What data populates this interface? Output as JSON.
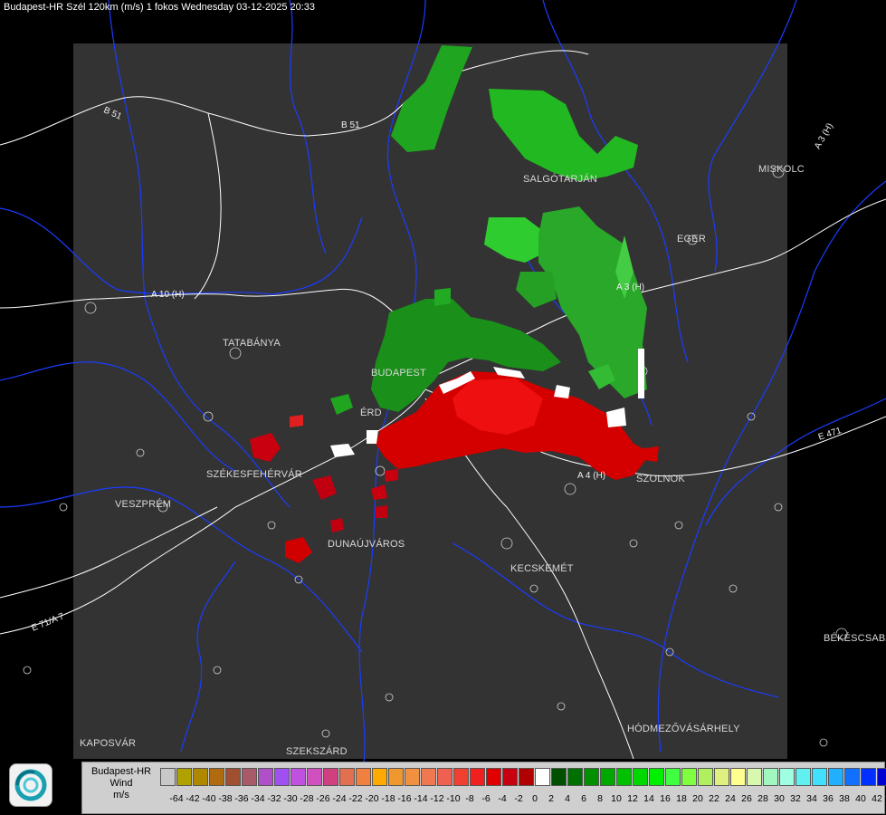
{
  "header": {
    "title": "Budapest-HR Szél 120km (m/s) 1 fokos Wednesday 03-12-2025 20:33"
  },
  "cities": [
    {
      "name": "SALGÓTARJÁN"
    },
    {
      "name": "EGER"
    },
    {
      "name": "MISKOLC"
    },
    {
      "name": "TATABÁNYA"
    },
    {
      "name": "BUDAPEST"
    },
    {
      "name": "ÉRD"
    },
    {
      "name": "SZÉKESFEHÉRVÁR"
    },
    {
      "name": "VESZPRÉM"
    },
    {
      "name": "DUNAÚJVÁROS"
    },
    {
      "name": "KECSKEMÉT"
    },
    {
      "name": "SZOLNOK"
    },
    {
      "name": "BÉKÉSCSABA"
    },
    {
      "name": "HÓDMEZŐVÁSÁRHELY"
    },
    {
      "name": "KAPOSVÁR"
    },
    {
      "name": "SZEKSZÁRD"
    }
  ],
  "roads": [
    {
      "name": "B 51"
    },
    {
      "name": "B 51"
    },
    {
      "name": "A 10 (H)"
    },
    {
      "name": "A 3 (H)"
    },
    {
      "name": "A 3 (H)"
    },
    {
      "name": "A 4 (H)"
    },
    {
      "name": "E 471"
    },
    {
      "name": "E 71/A 7"
    }
  ],
  "legend": {
    "line1": "Budapest-HR",
    "line2": "Wind",
    "line3": "m/s",
    "ticks": [
      "-64",
      "-42",
      "-40",
      "-38",
      "-36",
      "-34",
      "-32",
      "-30",
      "-28",
      "-26",
      "-24",
      "-22",
      "-20",
      "-18",
      "-16",
      "-14",
      "-12",
      "-10",
      "-8",
      "-6",
      "-4",
      "-2",
      "0",
      "2",
      "4",
      "6",
      "8",
      "10",
      "12",
      "14",
      "16",
      "18",
      "20",
      "22",
      "24",
      "26",
      "28",
      "30",
      "32",
      "34",
      "36",
      "38",
      "40",
      "42"
    ],
    "colors": [
      "#c8c8c8",
      "#b0a000",
      "#b08800",
      "#b06a10",
      "#a05030",
      "#a85a68",
      "#b050c8",
      "#a050f0",
      "#c050e0",
      "#d050c0",
      "#d04080",
      "#e07050",
      "#f08040",
      "#ffaa00",
      "#f09830",
      "#f09040",
      "#f07850",
      "#f06050",
      "#f04030",
      "#f02020",
      "#e00000",
      "#c80010",
      "#b00000",
      "#ffffff",
      "#005000",
      "#007000",
      "#009000",
      "#00a800",
      "#00c000",
      "#00d800",
      "#00f000",
      "#40ff40",
      "#80ff40",
      "#b0f060",
      "#e0f080",
      "#ffff90",
      "#d8f8b0",
      "#a0f8c0",
      "#a0ffe0",
      "#60f0f0",
      "#40e0ff",
      "#20b0ff",
      "#1070ff",
      "#0030ff",
      "#0000d0"
    ]
  },
  "colors": {
    "background": "#000000",
    "radar_area": "#333333",
    "borders": "#1a3cff",
    "roads": "#ffffff",
    "approaching": "#d40000",
    "receding": "#1fa51f"
  }
}
